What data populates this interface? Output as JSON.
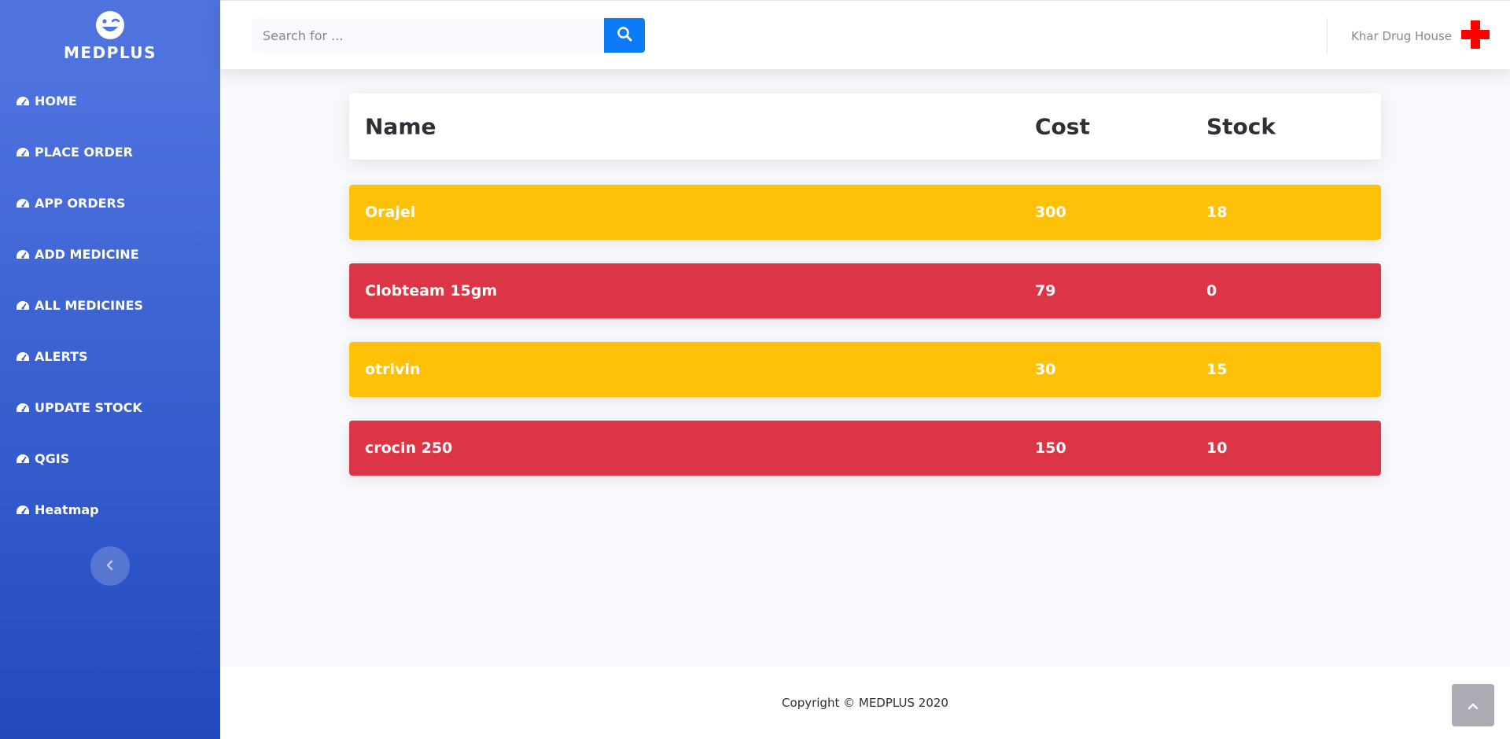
{
  "brand": {
    "name": "MEDPLUS",
    "icon": "laugh-wink-icon"
  },
  "sidebar": {
    "items": [
      {
        "label": "HOME",
        "icon": "tachometer-icon"
      },
      {
        "label": "PLACE ORDER",
        "icon": "tachometer-icon"
      },
      {
        "label": "APP ORDERS",
        "icon": "tachometer-icon"
      },
      {
        "label": "ADD MEDICINE",
        "icon": "tachometer-icon"
      },
      {
        "label": "ALL MEDICINES",
        "icon": "tachometer-icon"
      },
      {
        "label": "ALERTS",
        "icon": "tachometer-icon"
      },
      {
        "label": "UPDATE STOCK",
        "icon": "tachometer-icon"
      },
      {
        "label": "QGIS",
        "icon": "tachometer-icon"
      },
      {
        "label": "Heatmap",
        "icon": "tachometer-icon"
      }
    ],
    "toggle_icon": "chevron-left-icon"
  },
  "search": {
    "placeholder": "Search for ...",
    "value": "",
    "button_icon": "search-icon"
  },
  "user": {
    "name": "Khar Drug House",
    "icon": "red-cross-icon"
  },
  "table": {
    "headers": {
      "name": "Name",
      "cost": "Cost",
      "stock": "Stock"
    },
    "rows": [
      {
        "name": "Orajel",
        "cost": "300",
        "stock": "18",
        "status_color": "#fec107"
      },
      {
        "name": "Clobteam 15gm",
        "cost": "79",
        "stock": "0",
        "status_color": "#dc3545"
      },
      {
        "name": "otrivin",
        "cost": "30",
        "stock": "15",
        "status_color": "#fec107"
      },
      {
        "name": "crocin 250",
        "cost": "150",
        "stock": "10",
        "status_color": "#dc3545"
      }
    ]
  },
  "footer": {
    "copyright": "Copyright © MEDPLUS 2020"
  },
  "colors": {
    "sidebar_top": "#4e73df",
    "sidebar_bottom": "#224abe",
    "search_button": "#0d7bf5",
    "warning": "#fec107",
    "danger": "#dc3545"
  },
  "scroll_top_icon": "chevron-up-icon"
}
